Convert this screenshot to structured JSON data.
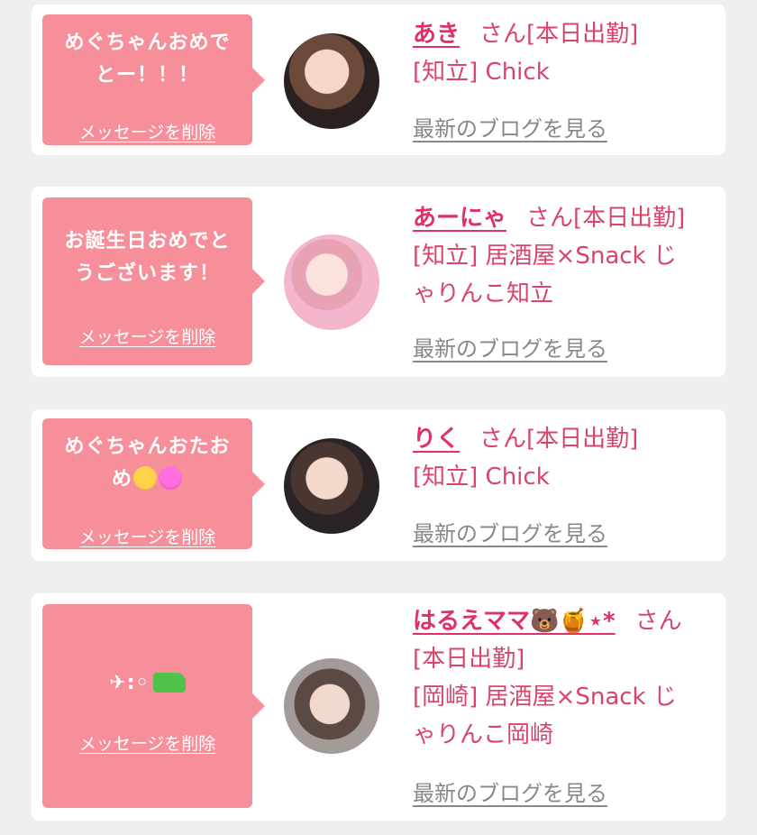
{
  "colors": {
    "bubble": "#f78f9b",
    "name": "#e02f6a",
    "text": "#d9456a",
    "link": "#888888",
    "background": "#efefef"
  },
  "cards": [
    {
      "message_lines": [
        "めぐちゃんおめで",
        "とー！！！"
      ],
      "delete_label": "メッセージを削除",
      "name": "あき",
      "san": "さん[本日出勤]",
      "shop_lines": [
        "[知立] Chick"
      ],
      "blog_label": "最新のブログを見る"
    },
    {
      "message_lines": [
        "お誕生日おめでと",
        "うございます！"
      ],
      "delete_label": "メッセージを削除",
      "name": "あーにゃ",
      "san": "さん[本日出勤]",
      "shop_lines": [
        "[知立] 居酒屋×Snack じ",
        "ゃりんこ知立"
      ],
      "blog_label": "最新のブログを見る"
    },
    {
      "message_lines": [
        "めぐちゃんおたお",
        "め"
      ],
      "message_icons": [
        "smiling-cat-heart-eyes-icon",
        "pink-heart-icon"
      ],
      "delete_label": "メッセージを削除",
      "name": "りく",
      "san": "さん[本日出勤]",
      "shop_lines": [
        "[知立] Chick"
      ],
      "blog_label": "最新のブログを見る"
    },
    {
      "message_lines": [
        "✈︎:◦"
      ],
      "message_icons": [
        "water-pistol-icon"
      ],
      "delete_label": "メッセージを削除",
      "name": "はるえママ🐻🍯⋆*",
      "san": "さん",
      "shop_lines": [
        "[本日出勤]",
        "[岡崎] 居酒屋×Snack じ",
        "ゃりんこ岡崎"
      ],
      "blog_label": "最新のブログを見る"
    }
  ]
}
